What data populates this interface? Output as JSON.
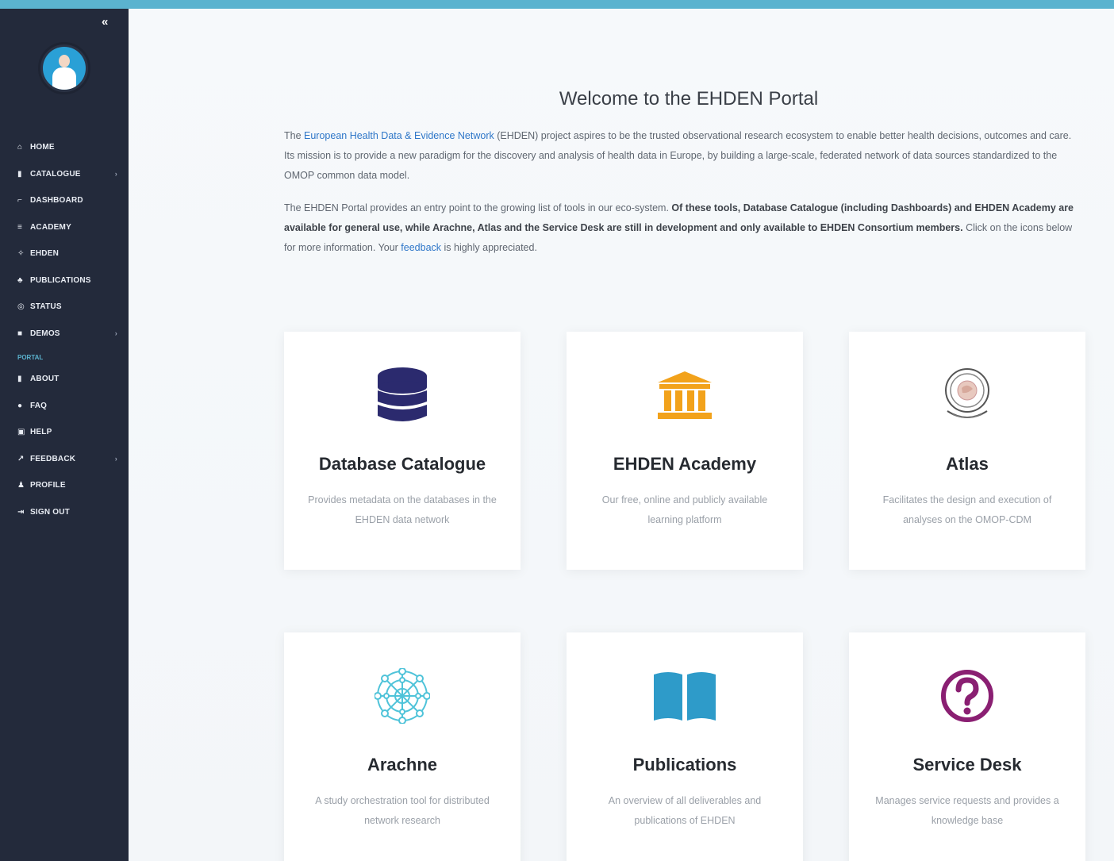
{
  "sidebar": {
    "collapse_label": "«",
    "items": [
      {
        "label": "HOME",
        "icon": "home-icon",
        "glyph": "⌂",
        "chevron": false
      },
      {
        "label": "CATALOGUE",
        "icon": "book-icon",
        "glyph": "▮",
        "chevron": true
      },
      {
        "label": "DASHBOARD",
        "icon": "chart-icon",
        "glyph": "⌐",
        "chevron": false
      },
      {
        "label": "ACADEMY",
        "icon": "academy-icon",
        "glyph": "≡",
        "chevron": false
      },
      {
        "label": "EHDEN",
        "icon": "ehden-icon",
        "glyph": "✧",
        "chevron": false
      },
      {
        "label": "PUBLICATIONS",
        "icon": "publications-icon",
        "glyph": "♣",
        "chevron": false
      },
      {
        "label": "STATUS",
        "icon": "status-icon",
        "glyph": "◎",
        "chevron": false
      },
      {
        "label": "DEMOS",
        "icon": "folder-icon",
        "glyph": "■",
        "chevron": true
      }
    ],
    "section_label": "PORTAL",
    "portal_items": [
      {
        "label": "ABOUT",
        "icon": "bookmark-icon",
        "glyph": "▮",
        "chevron": false
      },
      {
        "label": "FAQ",
        "icon": "question-icon",
        "glyph": "●",
        "chevron": false
      },
      {
        "label": "HELP",
        "icon": "help-icon",
        "glyph": "▣",
        "chevron": false
      },
      {
        "label": "FEEDBACK",
        "icon": "feedback-icon",
        "glyph": "↗",
        "chevron": true
      },
      {
        "label": "PROFILE",
        "icon": "user-icon",
        "glyph": "♟",
        "chevron": false
      },
      {
        "label": "SIGN OUT",
        "icon": "sign-out-icon",
        "glyph": "⇥",
        "chevron": false
      }
    ]
  },
  "main": {
    "title": "Welcome to the EHDEN Portal",
    "intro1_pre": "The ",
    "intro1_link": "European Health Data & Evidence Network",
    "intro1_post": " (EHDEN) project aspires to be the trusted observational research ecosystem to enable better health decisions, outcomes and care. Its mission is to provide a new paradigm for the discovery and analysis of health data in Europe, by building a large-scale, federated network of data sources standardized to the OMOP common data model.",
    "intro2_pre": "The EHDEN Portal provides an entry point to the growing list of tools in our eco-system. ",
    "intro2_bold": "Of these tools, Database Catalogue (including Dashboards) and EHDEN Academy are available for general use, while Arachne, Atlas and the Service Desk are still in development and only available to EHDEN Consortium members.",
    "intro2_mid": " Click on the icons below for more information. Your ",
    "intro2_link": "feedback",
    "intro2_post": " is highly appreciated."
  },
  "cards": [
    {
      "title": "Database Catalogue",
      "desc": "Provides metadata on the databases in the EHDEN data network",
      "icon": "database-icon",
      "color": "#2b2a6e"
    },
    {
      "title": "EHDEN Academy",
      "desc": "Our free, online and publicly available learning platform",
      "icon": "academy-building-icon",
      "color": "#f2a21b"
    },
    {
      "title": "Atlas",
      "desc": "Facilitates the design and execution of analyses on the OMOP-CDM",
      "icon": "atlas-globe-icon",
      "color": "#555555"
    },
    {
      "title": "Arachne",
      "desc": "A study orchestration tool for distributed network research",
      "icon": "arachne-network-icon",
      "color": "#4fc3d9"
    },
    {
      "title": "Publications",
      "desc": "An overview of all deliverables and publications of EHDEN",
      "icon": "open-book-icon",
      "color": "#2e9bc9"
    },
    {
      "title": "Service Desk",
      "desc": "Manages service requests and provides a knowledge base",
      "icon": "question-circle-icon",
      "color": "#8a1f72"
    }
  ]
}
